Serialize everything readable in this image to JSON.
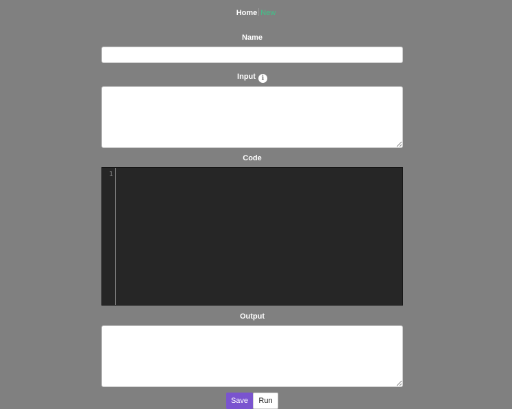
{
  "nav": {
    "home_label": "Home",
    "new_label": "New",
    "new_color": "#3ec48a"
  },
  "form": {
    "name_label": "Name",
    "name_value": "",
    "input_label": "Input",
    "input_info_icon": "info-icon",
    "input_value": "",
    "code_label": "Code",
    "code_line_numbers": [
      "1"
    ],
    "code_value": "",
    "output_label": "Output",
    "output_value": ""
  },
  "actions": {
    "save_label": "Save",
    "run_label": "Run",
    "save_color": "#7a54cf"
  },
  "colors": {
    "background": "#808080",
    "editor_background": "#262626"
  }
}
